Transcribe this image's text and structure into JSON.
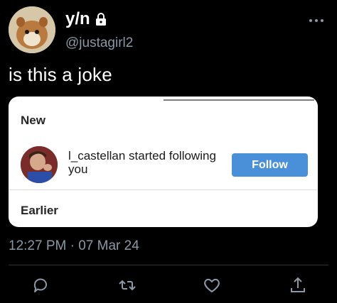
{
  "author": {
    "display_name": "y/n",
    "handle": "@justagirl2"
  },
  "tweet": {
    "text": "is this a joke",
    "timestamp": "12:27 PM · 07 Mar 24"
  },
  "notification_card": {
    "section_new": "New",
    "notification_text": "l_castellan started following you",
    "follow_label": "Follow",
    "section_earlier": "Earlier"
  },
  "colors": {
    "background": "#000000",
    "follow_button": "#4a90d9",
    "muted_text": "#8b98a5"
  },
  "icons": [
    "lock-icon",
    "more-icon",
    "reply-icon",
    "retweet-icon",
    "like-icon",
    "share-icon"
  ]
}
